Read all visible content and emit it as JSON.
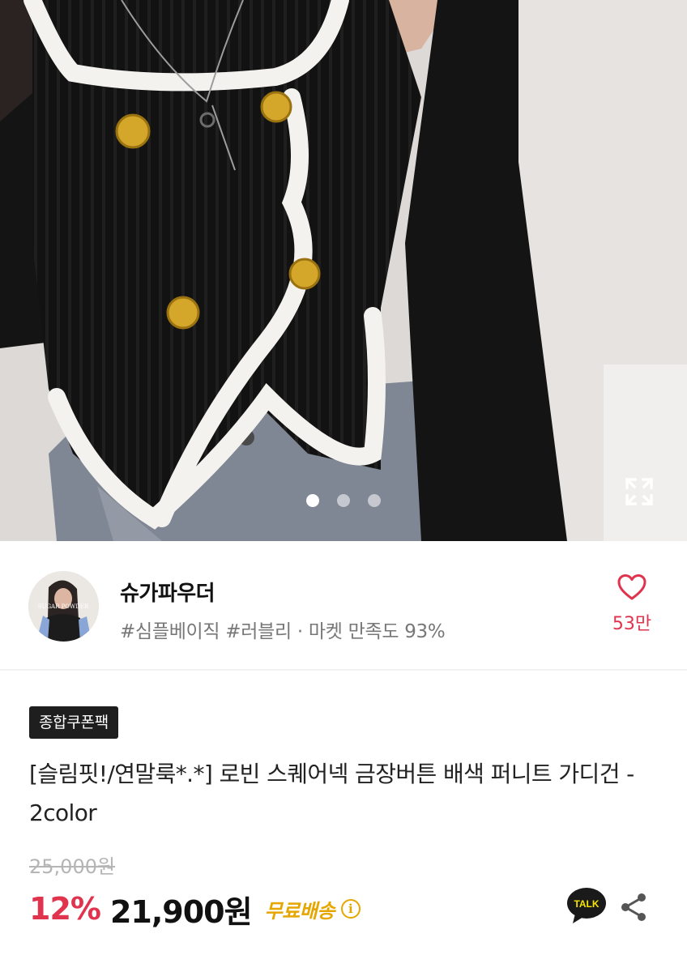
{
  "gallery": {
    "dots_count": 3,
    "active_index": 0,
    "expand_icon": "expand-icon"
  },
  "shop": {
    "name": "슈가파우더",
    "tags": "#심플베이직 #러블리 · 마켓 만족도 93%",
    "avatar_text": "SUGAR POWDER",
    "like_icon": "heart-icon",
    "like_count": "53만"
  },
  "product": {
    "badge": "종합쿠폰팩",
    "title": "[슬림핏!/연말룩*.*] 로빈 스퀘어넥 금장버튼 배색 퍼니트 가디건 - 2color",
    "original_price": "25,000원",
    "discount": "12%",
    "price": "21,900원",
    "shipping": "무료배송",
    "info_icon_glyph": "i"
  },
  "actions": {
    "talk_label": "TALK",
    "share_icon": "share-icon"
  },
  "colors": {
    "accent_red": "#e0344e",
    "shipping_yellow": "#e6a600",
    "kakao_yellow": "#f7e600"
  }
}
